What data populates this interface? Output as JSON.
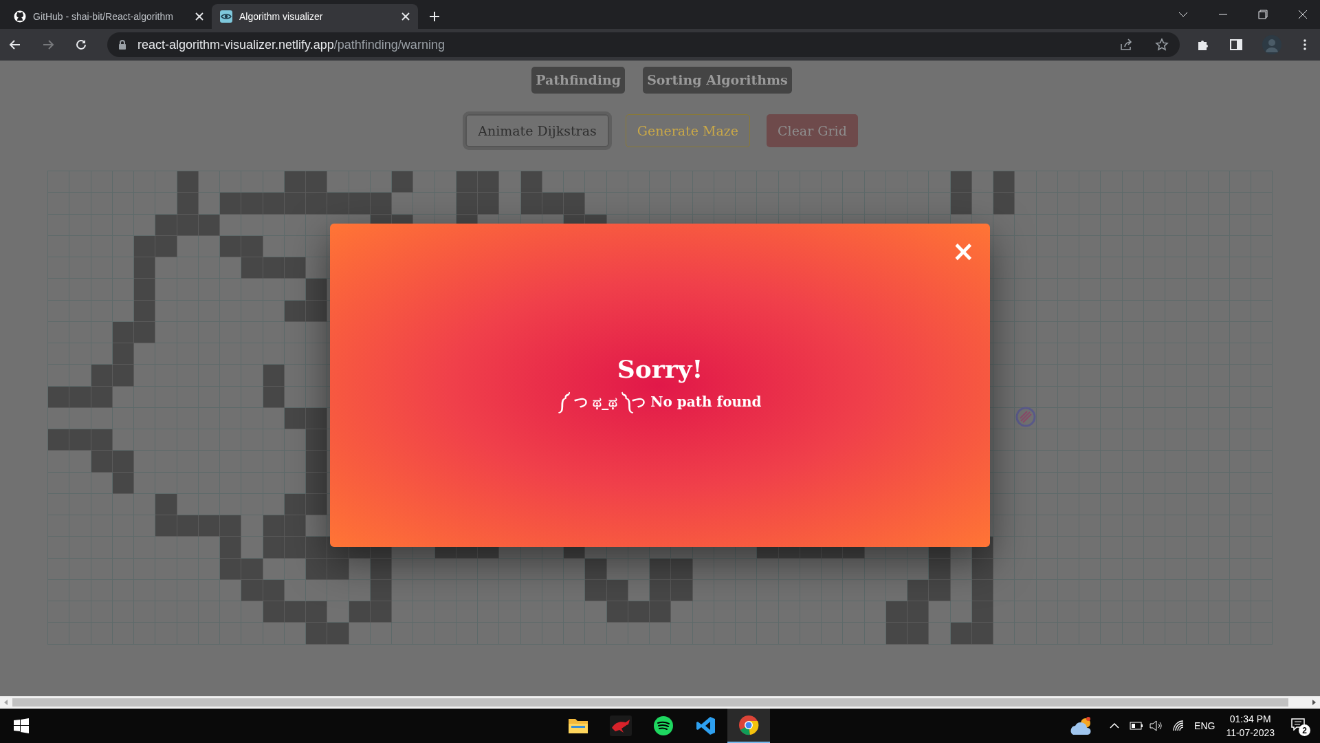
{
  "browser": {
    "tabs": [
      {
        "title": "GitHub - shai-bit/React-algorithm",
        "selected": false
      },
      {
        "title": "Algorithm visualizer",
        "selected": true
      }
    ],
    "url_host": "react-algorithm-visualizer.netlify.app",
    "url_path": "/pathfinding/warning"
  },
  "nav": [
    {
      "label": "Pathfinding"
    },
    {
      "label": "Sorting Algorithms"
    }
  ],
  "actions": [
    {
      "label": "Animate Dijkstras",
      "kind": "outline"
    },
    {
      "label": "Generate Maze",
      "kind": "warning"
    },
    {
      "label": "Clear Grid",
      "kind": "danger"
    }
  ],
  "grid": {
    "walls": [
      {
        "cells": [
          false,
          false,
          false,
          false,
          false,
          false,
          true,
          false,
          false,
          false,
          false,
          true,
          true,
          false,
          false,
          false,
          true,
          false,
          false,
          true,
          true,
          false,
          true,
          false,
          false,
          false,
          false,
          false,
          false,
          false,
          false,
          false,
          false,
          false,
          false,
          false,
          false,
          false,
          false,
          false,
          false,
          false,
          true,
          false,
          true,
          false,
          false,
          false,
          false,
          false,
          false,
          false,
          false,
          false,
          false,
          false,
          false
        ]
      },
      {
        "cells": [
          false,
          false,
          false,
          false,
          false,
          false,
          true,
          false,
          true,
          true,
          true,
          true,
          true,
          true,
          true,
          true,
          false,
          false,
          false,
          true,
          true,
          false,
          true,
          true,
          true,
          false,
          false,
          false,
          false,
          false,
          false,
          false,
          false,
          false,
          false,
          false,
          false,
          false,
          false,
          false,
          false,
          false,
          true,
          false,
          true,
          false,
          false,
          false,
          false,
          false,
          false,
          false,
          false,
          false,
          false,
          false,
          false
        ]
      },
      {
        "cells": [
          false,
          false,
          false,
          false,
          false,
          true,
          true,
          true,
          false,
          false,
          false,
          false,
          false,
          false,
          false,
          true,
          true,
          false,
          false,
          true,
          false,
          false,
          false,
          false,
          true,
          true,
          false,
          false,
          false,
          false,
          false,
          false,
          false,
          false,
          false,
          false,
          false,
          false,
          false,
          false,
          false,
          false,
          false,
          false,
          false,
          false,
          false,
          false,
          false,
          false,
          false,
          false,
          false,
          false,
          false,
          false,
          false
        ]
      },
      {
        "left": [
          false,
          false,
          false,
          false,
          true,
          true,
          false,
          false,
          true,
          true,
          false,
          false,
          false,
          false
        ],
        "right": [
          false,
          false,
          false,
          false,
          false,
          false,
          false,
          false,
          false,
          false,
          false,
          false,
          false,
          false
        ]
      },
      {
        "left": [
          false,
          false,
          false,
          false,
          true,
          false,
          false,
          false,
          false,
          true,
          true,
          true,
          false,
          false
        ],
        "right": [
          false,
          false,
          false,
          false,
          false,
          false,
          false,
          false,
          false,
          false,
          false,
          false,
          false,
          false
        ]
      },
      {
        "left": [
          false,
          false,
          false,
          false,
          true,
          false,
          false,
          false,
          false,
          false,
          false,
          false,
          true,
          false
        ],
        "right": [
          false,
          false,
          false,
          false,
          false,
          false,
          false,
          false,
          false,
          false,
          false,
          false,
          false,
          false
        ]
      },
      {
        "left": [
          false,
          false,
          false,
          false,
          true,
          false,
          false,
          false,
          false,
          false,
          false,
          true,
          true,
          false
        ],
        "right": [
          false,
          false,
          false,
          false,
          false,
          false,
          false,
          false,
          false,
          false,
          false,
          false,
          false,
          false
        ]
      },
      {
        "left": [
          false,
          false,
          false,
          true,
          true,
          false,
          false,
          false,
          false,
          false,
          false,
          false,
          false,
          false
        ],
        "right": [
          false,
          false,
          false,
          false,
          false,
          false,
          false,
          false,
          false,
          false,
          false,
          false,
          false,
          false
        ]
      },
      {
        "left": [
          false,
          false,
          false,
          true,
          false,
          false,
          false,
          false,
          false,
          false,
          false,
          false,
          false,
          false
        ],
        "right": [
          false,
          false,
          false,
          false,
          false,
          false,
          false,
          false,
          false,
          false,
          false,
          false,
          false,
          false
        ]
      },
      {
        "left": [
          false,
          false,
          true,
          true,
          false,
          false,
          false,
          false,
          false,
          false,
          true,
          false,
          false,
          false
        ],
        "right": [
          false,
          false,
          false,
          false,
          false,
          false,
          false,
          false,
          false,
          false,
          false,
          false,
          false,
          false
        ]
      },
      {
        "left": [
          true,
          true,
          true,
          false,
          false,
          false,
          false,
          false,
          false,
          false,
          true,
          false,
          false,
          false
        ],
        "right": [
          false,
          false,
          false,
          false,
          false,
          false,
          false,
          false,
          false,
          false,
          false,
          false,
          false,
          false
        ]
      },
      {
        "left": [
          false,
          false,
          false,
          false,
          false,
          false,
          false,
          false,
          false,
          false,
          false,
          true,
          true,
          false
        ],
        "right": [
          false,
          false,
          false,
          false,
          false,
          false,
          false,
          false,
          false,
          false,
          false,
          false,
          false,
          false
        ]
      },
      {
        "left": [
          true,
          true,
          true,
          false,
          false,
          false,
          false,
          false,
          false,
          false,
          false,
          false,
          true,
          false
        ],
        "right": [
          false,
          false,
          false,
          false,
          false,
          false,
          false,
          false,
          false,
          false,
          false,
          false,
          false,
          false
        ]
      },
      {
        "left": [
          false,
          false,
          true,
          true,
          false,
          false,
          false,
          false,
          false,
          false,
          false,
          false,
          true,
          false
        ],
        "right": [
          false,
          false,
          false,
          false,
          false,
          false,
          false,
          false,
          false,
          false,
          false,
          false,
          false,
          false
        ]
      },
      {
        "left": [
          false,
          false,
          false,
          true,
          false,
          false,
          false,
          false,
          false,
          false,
          false,
          false,
          true,
          false
        ],
        "right": [
          false,
          false,
          false,
          false,
          false,
          false,
          false,
          false,
          false,
          false,
          false,
          false,
          false,
          false
        ]
      },
      {
        "left": [
          false,
          false,
          false,
          false,
          false,
          true,
          false,
          false,
          false,
          false,
          false,
          true,
          true,
          false
        ],
        "right": [
          false,
          false,
          false,
          false,
          false,
          false,
          false,
          false,
          false,
          false,
          false,
          false,
          false,
          false
        ]
      },
      {
        "left": [
          false,
          false,
          false,
          false,
          false,
          true,
          true,
          true,
          true,
          false,
          true,
          true,
          false,
          false
        ],
        "right": [
          false,
          false,
          false,
          false,
          false,
          false,
          false,
          false,
          false,
          false,
          false,
          false,
          false,
          false
        ]
      },
      {
        "cells": [
          false,
          false,
          false,
          false,
          false,
          false,
          false,
          false,
          true,
          false,
          true,
          true,
          true,
          true,
          true,
          true,
          false,
          false,
          true,
          true,
          true,
          false,
          false,
          false,
          true,
          false,
          false,
          false,
          false,
          false,
          false,
          false,
          false,
          true,
          true,
          true,
          true,
          true,
          false,
          false,
          false,
          true,
          false,
          true,
          false,
          false,
          false,
          false,
          false,
          false,
          false,
          false,
          false,
          false,
          false,
          false,
          false
        ]
      },
      {
        "cells": [
          false,
          false,
          false,
          false,
          false,
          false,
          false,
          false,
          true,
          true,
          false,
          false,
          true,
          true,
          false,
          true,
          false,
          false,
          false,
          false,
          false,
          false,
          false,
          false,
          false,
          true,
          false,
          false,
          true,
          true,
          false,
          false,
          false,
          false,
          false,
          false,
          false,
          false,
          false,
          false,
          false,
          true,
          false,
          true,
          false,
          false,
          false,
          false,
          false,
          false,
          false,
          false,
          false,
          false,
          false,
          false,
          false
        ]
      },
      {
        "cells": [
          false,
          false,
          false,
          false,
          false,
          false,
          false,
          false,
          false,
          true,
          true,
          false,
          false,
          false,
          false,
          true,
          false,
          false,
          false,
          false,
          false,
          false,
          false,
          false,
          false,
          true,
          true,
          false,
          true,
          true,
          false,
          false,
          false,
          false,
          false,
          false,
          false,
          false,
          false,
          false,
          true,
          true,
          false,
          true,
          false,
          false,
          false,
          false,
          false,
          false,
          false,
          false,
          false,
          false,
          false,
          false,
          false
        ]
      },
      {
        "cells": [
          false,
          false,
          false,
          false,
          false,
          false,
          false,
          false,
          false,
          false,
          true,
          true,
          true,
          false,
          true,
          true,
          false,
          false,
          false,
          false,
          false,
          false,
          false,
          false,
          false,
          false,
          true,
          true,
          true,
          false,
          false,
          false,
          false,
          false,
          false,
          false,
          false,
          false,
          false,
          true,
          true,
          false,
          false,
          true,
          false,
          false,
          false,
          false,
          false,
          false,
          false,
          false,
          false,
          false,
          false,
          false,
          false
        ]
      },
      {
        "cells": [
          false,
          false,
          false,
          false,
          false,
          false,
          false,
          false,
          false,
          false,
          false,
          false,
          true,
          true,
          false,
          false,
          false,
          false,
          false,
          false,
          false,
          false,
          false,
          false,
          false,
          false,
          false,
          false,
          false,
          false,
          false,
          false,
          false,
          false,
          false,
          false,
          false,
          false,
          false,
          true,
          true,
          false,
          true,
          true,
          false,
          false,
          false,
          false,
          false,
          false,
          false,
          false,
          false,
          false,
          false,
          false,
          false
        ]
      }
    ]
  },
  "modal": {
    "title": "Sorry!",
    "message": "༼ つ ಥ_ಥ ༽つ No path found",
    "close": "×"
  },
  "taskbar": {
    "apps": [
      {
        "kind": "explorer",
        "active": false
      },
      {
        "kind": "dragon",
        "active": false
      },
      {
        "kind": "spotify",
        "active": false
      },
      {
        "kind": "vscode",
        "active": false
      },
      {
        "kind": "chrome",
        "active": true
      }
    ],
    "language": "ENG",
    "time": "01:34 PM",
    "date": "11-07-2023",
    "notifications": "2"
  }
}
